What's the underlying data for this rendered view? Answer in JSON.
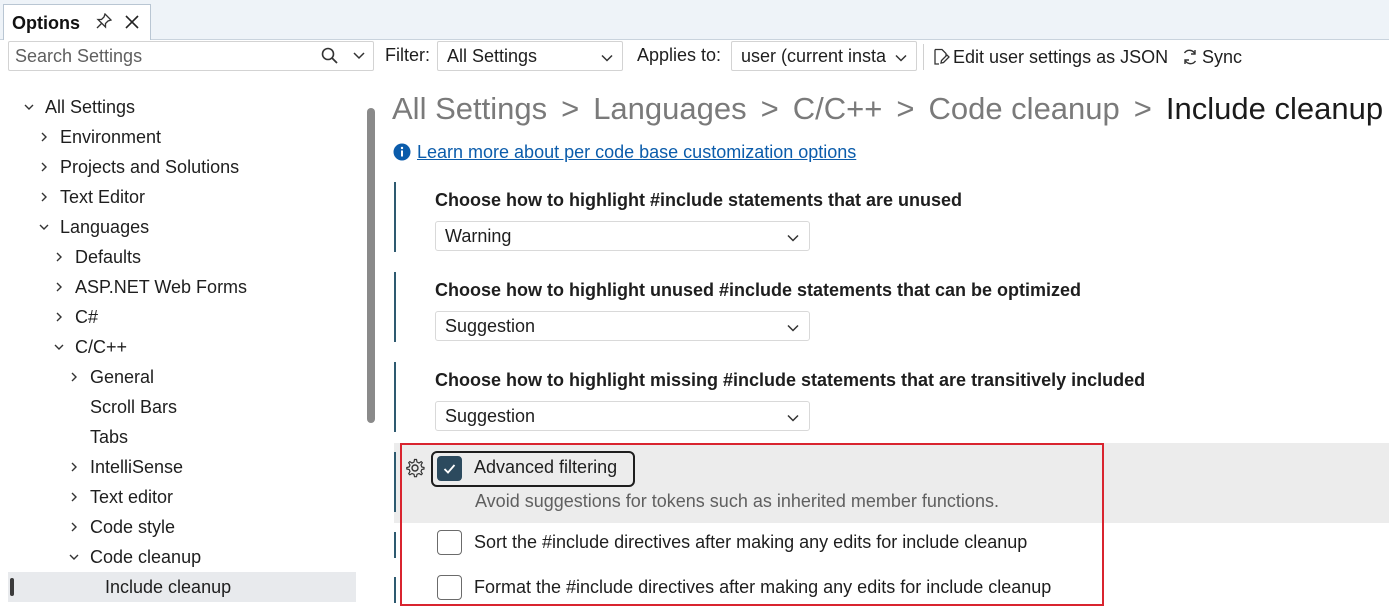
{
  "window": {
    "tab_title": "Options"
  },
  "toolbar": {
    "search_placeholder": "Search Settings",
    "filter_label": "Filter:",
    "filter_value": "All Settings",
    "applies_label": "Applies to:",
    "applies_value": "user (current insta",
    "edit_json_label": "Edit user settings as JSON",
    "sync_label": "Sync"
  },
  "tree": {
    "items": [
      {
        "label": "All Settings",
        "expanded": true
      },
      {
        "label": "Environment",
        "expanded": false
      },
      {
        "label": "Projects and Solutions",
        "expanded": false
      },
      {
        "label": "Text Editor",
        "expanded": false
      },
      {
        "label": "Languages",
        "expanded": true
      },
      {
        "label": "Defaults",
        "expanded": false
      },
      {
        "label": "ASP.NET Web Forms",
        "expanded": false
      },
      {
        "label": "C#",
        "expanded": false
      },
      {
        "label": "C/C++",
        "expanded": true
      },
      {
        "label": "General",
        "expanded": false
      },
      {
        "label": "Scroll Bars"
      },
      {
        "label": "Tabs"
      },
      {
        "label": "IntelliSense",
        "expanded": false
      },
      {
        "label": "Text editor",
        "expanded": false
      },
      {
        "label": "Code style",
        "expanded": false
      },
      {
        "label": "Code cleanup",
        "expanded": true
      },
      {
        "label": "Include cleanup",
        "selected": true
      }
    ]
  },
  "breadcrumb": {
    "parts": [
      "All Settings",
      "Languages",
      "C/C++",
      "Code cleanup"
    ],
    "separator": ">",
    "current": "Include cleanup"
  },
  "info": {
    "link_text": "Learn more about per code base customization options"
  },
  "settings": [
    {
      "title": "Choose how to highlight #include statements that are unused",
      "value": "Warning"
    },
    {
      "title": "Choose how to highlight unused #include statements that can be optimized",
      "value": "Suggestion"
    },
    {
      "title": "Choose how to highlight missing #include statements that are transitively included",
      "value": "Suggestion"
    }
  ],
  "checkboxes": [
    {
      "label": "Advanced filtering",
      "checked": true,
      "description": "Avoid suggestions for tokens such as inherited member functions."
    },
    {
      "label": "Sort the #include directives after making any edits for include cleanup",
      "checked": false
    },
    {
      "label": "Format the #include directives after making any edits for include cleanup",
      "checked": false
    }
  ],
  "colors": {
    "accent": "#2c4a5e",
    "link": "#0b5cab",
    "highlight_frame": "#d9242f"
  }
}
